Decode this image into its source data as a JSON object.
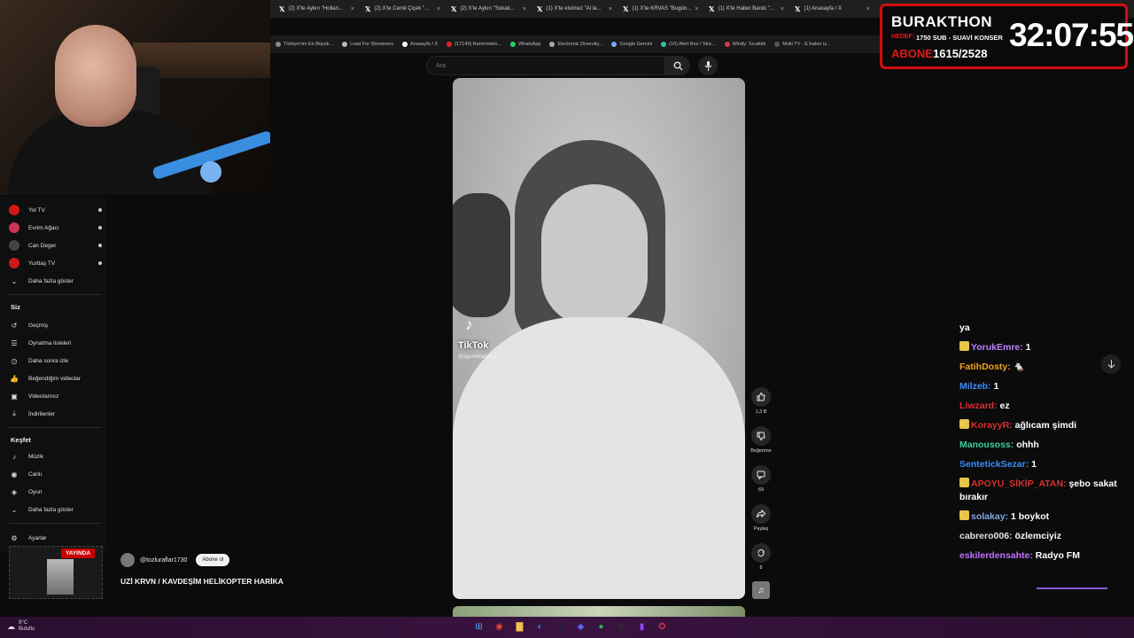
{
  "browser": {
    "tabs": [
      {
        "label": "(2) X'te Aykırı \"Hollan..."
      },
      {
        "label": "(2) X'te Cemil Çiçek \"..."
      },
      {
        "label": "(2) X'te Aykırı \"Sokak..."
      },
      {
        "label": "(1) X'te elulmez \"Al la..."
      },
      {
        "label": "(1) X'te KRVAS \"Bugün..."
      },
      {
        "label": "(1) X'te Haber Bandı \"..."
      },
      {
        "label": "(1) Anasayfa / X"
      }
    ],
    "bookmarks": [
      {
        "label": "Türkiye'nin En Büyük...",
        "color": "#888888"
      },
      {
        "label": "Load For Streamers",
        "color": "#bbbbbb"
      },
      {
        "label": "Anasayfa / X",
        "color": "#ffffff"
      },
      {
        "label": "(17143) Rammstein...",
        "color": "#e02020"
      },
      {
        "label": "WhatsApp",
        "color": "#25d366"
      },
      {
        "label": "Electronic Diversity...",
        "color": "#aaaaaa"
      },
      {
        "label": "Google Gemini",
        "color": "#7aa7ff"
      },
      {
        "label": "(10) Alert Box / Stre...",
        "color": "#31c3a2"
      },
      {
        "label": "Windy: Sıcaklık",
        "color": "#dd3355"
      },
      {
        "label": "Multi TV - E haber iz...",
        "color": "#555555"
      }
    ],
    "search_placeholder": "Ara"
  },
  "sidebar": {
    "subscriptions": [
      {
        "label": "Yol TV",
        "color": "#d01818"
      },
      {
        "label": "Evrim Ağacı",
        "color": "#cc3355"
      },
      {
        "label": "Can Deger",
        "color": "#444444"
      },
      {
        "label": "Yurttaş TV",
        "color": "#d01818"
      }
    ],
    "show_more_1": "Daha fazla göster",
    "you_heading": "Siz",
    "you_items": [
      {
        "label": "Geçmiş",
        "icon": "history-icon"
      },
      {
        "label": "Oynatma listeleri",
        "icon": "playlist-icon"
      },
      {
        "label": "Daha sonra izle",
        "icon": "clock-icon"
      },
      {
        "label": "Beğendiğim videolar",
        "icon": "thumbs-up-icon"
      },
      {
        "label": "Videolarınız",
        "icon": "video-icon"
      },
      {
        "label": "İndirilenler",
        "icon": "download-icon"
      }
    ],
    "explore_heading": "Keşfet",
    "explore_items": [
      {
        "label": "Müzik",
        "icon": "music-icon"
      },
      {
        "label": "Canlı",
        "icon": "live-icon"
      },
      {
        "label": "Oyun",
        "icon": "game-icon"
      }
    ],
    "show_more_2": "Daha fazla göster",
    "settings": "Ayarlar"
  },
  "video": {
    "watermark": "TikTok",
    "watermark_handle": "@aycelilkadenizz"
  },
  "actions": {
    "like_count": "1,3 B",
    "dislike_label": "Beğenme",
    "comments_count": "69",
    "share_label": "Paylaş",
    "remix_count": "8"
  },
  "channel": {
    "handle": "@tozluraflar1730",
    "subscribe_label": "Abone ol",
    "title": "UZİ KRVN / KAVDEŞİM HELİKOPTER HARİKA"
  },
  "miniplayer": {
    "badge": "YAYINDA"
  },
  "overlay": {
    "brand": "BURAKTHON",
    "hedef_label": "HEDEF:",
    "hedef_text": "1750 SUB - SUAVİ KONSER",
    "abone_label": "ABONE",
    "abone_value": "1615/2528",
    "timer": "32:07:55"
  },
  "chat": {
    "messages": [
      {
        "user": "",
        "text": "ya",
        "color": "#ffffff",
        "badge": false
      },
      {
        "user": "YorukEmre:",
        "text": "1",
        "color": "#b980ff",
        "badge": true
      },
      {
        "user": "FatihDosty:",
        "text": "🐁",
        "color": "#f0a020",
        "badge": false
      },
      {
        "user": "Milzeb:",
        "text": "1",
        "color": "#3c8cff",
        "badge": false
      },
      {
        "user": "Liwzard:",
        "text": "ez",
        "color": "#d83030",
        "badge": false
      },
      {
        "user": "KorayyR:",
        "text": "ağlıcam şimdi",
        "color": "#d83030",
        "badge": true
      },
      {
        "user": "Manousoss:",
        "text": "ohhh",
        "color": "#3cd0a0",
        "badge": false
      },
      {
        "user": "SentetickSezar:",
        "text": "1",
        "color": "#3c8cff",
        "badge": false
      },
      {
        "user": "APOYU_SİKİP_ATAN:",
        "text": "şebo sakat bırakır",
        "color": "#d83030",
        "badge": true
      },
      {
        "user": "solakay:",
        "text": "1 boykot",
        "color": "#7fa8e0",
        "badge": true
      },
      {
        "user": "cabrero006:",
        "text": "özlemciyiz",
        "color": "#e0e0e0",
        "badge": false
      },
      {
        "user": "eskilerdensahte:",
        "text": "Radyo FM",
        "color": "#c070ff",
        "badge": false
      }
    ]
  },
  "taskbar": {
    "temperature": "9°C",
    "condition": "Bulutlu",
    "apps": [
      {
        "name": "windows-start-icon",
        "color": "#4aa3ff",
        "glyph": "⊞"
      },
      {
        "name": "chrome-icon",
        "color": "#e8453c",
        "glyph": "◉"
      },
      {
        "name": "file-explorer-icon",
        "color": "#f2c14e",
        "glyph": "▇"
      },
      {
        "name": "edge-icon",
        "color": "#2a88d8",
        "glyph": "◐"
      },
      {
        "name": "steam-icon",
        "color": "#1b2838",
        "glyph": "●"
      },
      {
        "name": "discord-icon",
        "color": "#5865f2",
        "glyph": "◆"
      },
      {
        "name": "spotify-icon",
        "color": "#1db954",
        "glyph": "●"
      },
      {
        "name": "obs-icon",
        "color": "#333333",
        "glyph": "◎"
      },
      {
        "name": "twitch-icon",
        "color": "#9146ff",
        "glyph": "▮"
      },
      {
        "name": "misc-app-icon",
        "color": "#cc3355",
        "glyph": "✪"
      }
    ]
  }
}
